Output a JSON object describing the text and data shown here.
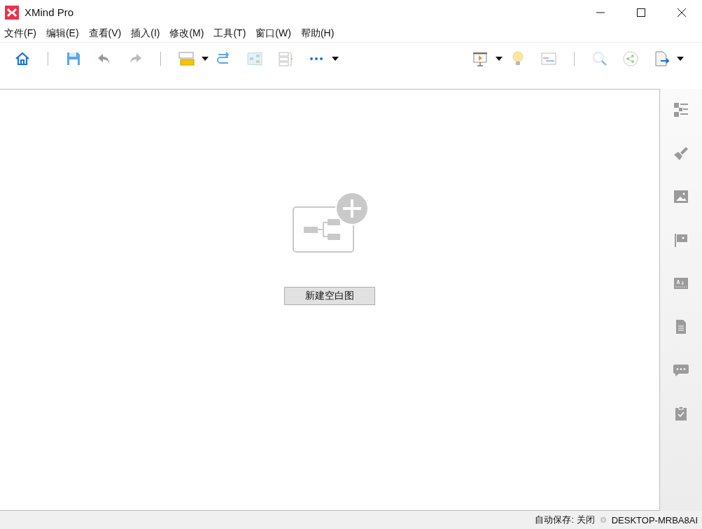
{
  "window": {
    "title": "XMind Pro"
  },
  "menu": [
    "文件(F)",
    "编辑(E)",
    "查看(V)",
    "插入(I)",
    "修改(M)",
    "工具(T)",
    "窗口(W)",
    "帮助(H)"
  ],
  "canvas": {
    "button": "新建空白图"
  },
  "status_bar": {
    "autosave": "自动保存: 关闭",
    "device": "DESKTOP-MRBA8AI"
  }
}
